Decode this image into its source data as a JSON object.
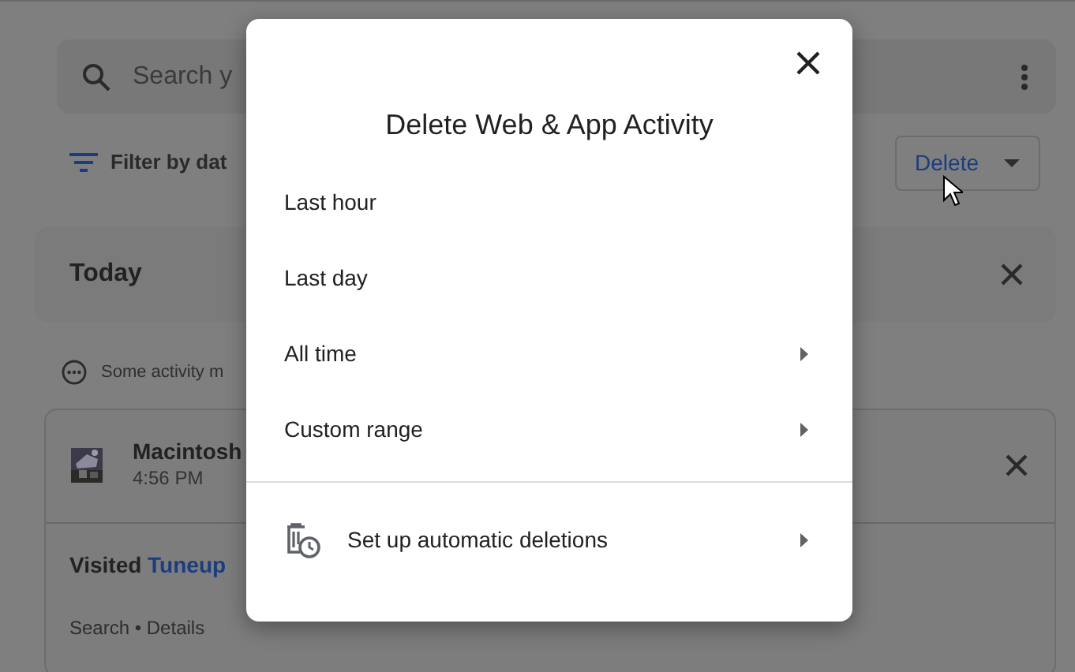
{
  "page": {
    "search": {
      "placeholder": "Search y"
    },
    "filter": {
      "label": "Filter by dat"
    },
    "delete_button": {
      "label": "Delete"
    },
    "today": {
      "label": "Today"
    },
    "notice": {
      "text": "Some activity m"
    },
    "activity_card": {
      "title": "Macintosh",
      "time": "4:56 PM",
      "prefix": "Visited",
      "link": "Tuneup",
      "meta": "Search • Details"
    }
  },
  "dialog": {
    "title": "Delete Web & App Activity",
    "options": [
      {
        "label": "Last hour",
        "submenu": false
      },
      {
        "label": "Last day",
        "submenu": false
      },
      {
        "label": "All time",
        "submenu": true
      },
      {
        "label": "Custom range",
        "submenu": true
      }
    ],
    "footer_option": {
      "label": "Set up automatic deletions",
      "submenu": true
    }
  }
}
